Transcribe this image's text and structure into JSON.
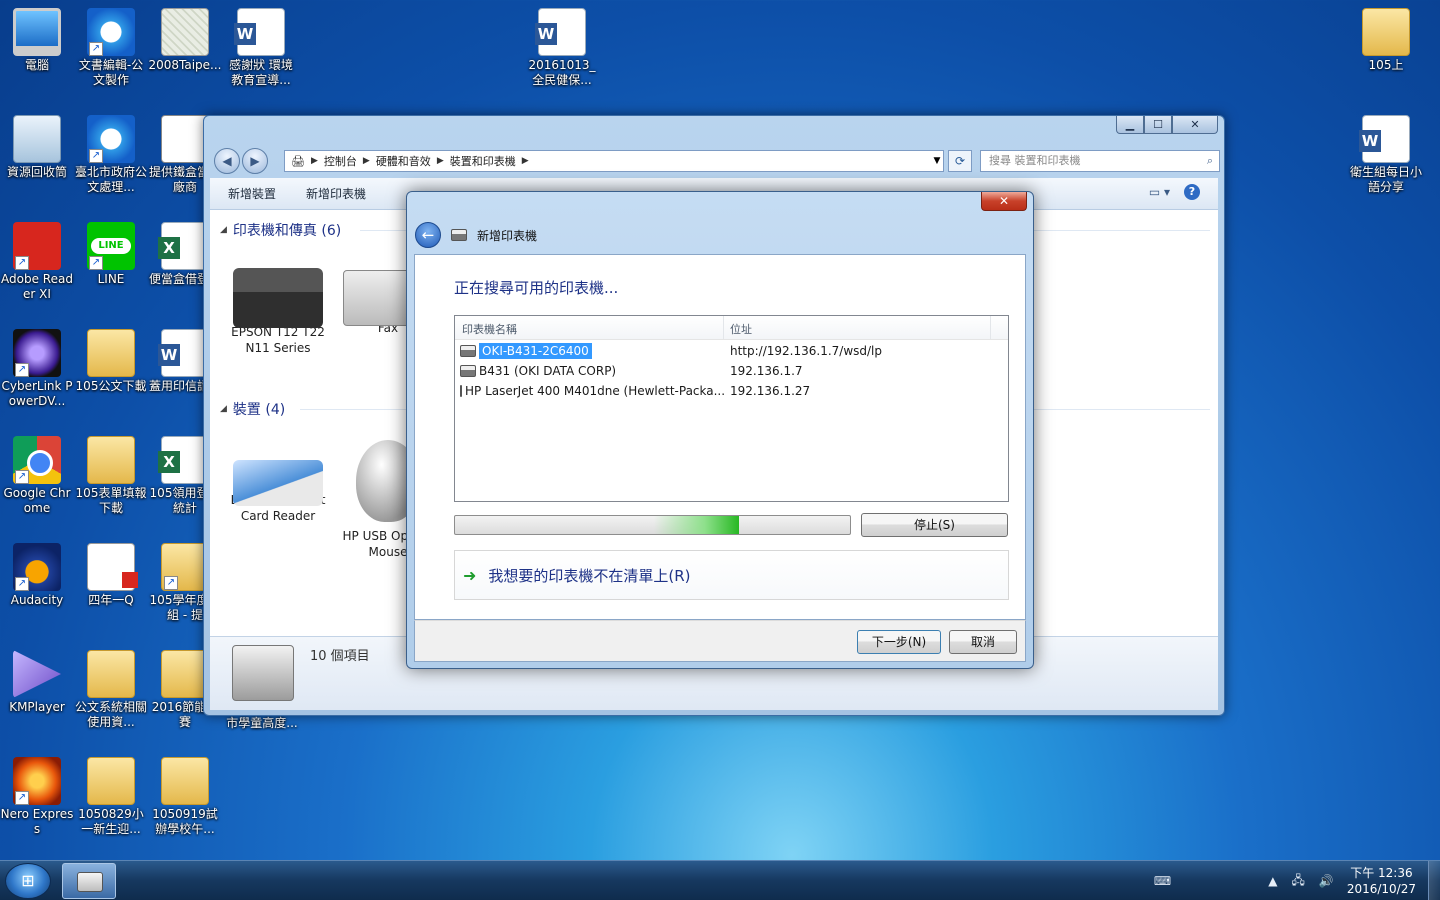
{
  "desktop": {
    "icons": [
      {
        "label": "電腦"
      },
      {
        "label": "文書編輯-公文製作"
      },
      {
        "label": "2008Taipe..."
      },
      {
        "label": "感謝狀 環境教育宣導..."
      },
      {
        "label": "20161013_全民健保..."
      },
      {
        "label": "105上"
      },
      {
        "label": "資源回收筒"
      },
      {
        "label": "臺北市政府公文處理..."
      },
      {
        "label": "提供鐵盒當之廠商"
      },
      {
        "label": "衛生組每日小語分享"
      },
      {
        "label": "Adobe Reader XI"
      },
      {
        "label": "LINE"
      },
      {
        "label": "便當盒借登記"
      },
      {
        "label": "CyberLink PowerDV..."
      },
      {
        "label": "105公文下載"
      },
      {
        "label": "蓋用印信請表"
      },
      {
        "label": "Google Chrome"
      },
      {
        "label": "105表單填報下載"
      },
      {
        "label": "105領用登記統計"
      },
      {
        "label": "Audacity"
      },
      {
        "label": "四年一Q"
      },
      {
        "label": "105學年度生組 - 提"
      },
      {
        "label": "KMPlayer"
      },
      {
        "label": "公文系統相關使用資..."
      },
      {
        "label": "2016節能競賽"
      },
      {
        "label": "Nero Express"
      },
      {
        "label": "1050829小一新生迎..."
      },
      {
        "label": "1050919試辦學校午..."
      },
      {
        "label": "市學童高度..."
      }
    ]
  },
  "explorer": {
    "breadcrumb": [
      "控制台",
      "硬體和音效",
      "裝置和印表機"
    ],
    "search_placeholder": "搜尋 裝置和印表機",
    "toolbar": {
      "add_device": "新增裝置",
      "add_printer": "新增印表機"
    },
    "groups": {
      "printers_title": "印表機和傳真 (6)",
      "devices_title": "裝置 (4)"
    },
    "printers": [
      {
        "label": "EPSON T12 T22 N11 Series"
      },
      {
        "label": "Fax"
      }
    ],
    "devices": [
      {
        "label": "EZ100PU Smart Card Reader"
      },
      {
        "label": "HP USB Optical Mouse"
      }
    ],
    "status": {
      "count": "10 個項目"
    }
  },
  "dialog": {
    "window_title": "新增印表機",
    "heading": "正在搜尋可用的印表機...",
    "columns": {
      "name": "印表機名稱",
      "address": "位址"
    },
    "rows": [
      {
        "name": "OKI-B431-2C6400",
        "address": "http://192.136.1.7/wsd/lp"
      },
      {
        "name": "B431 (OKI DATA CORP)",
        "address": "192.136.1.7"
      },
      {
        "name": "HP LaserJet 400 M401dne (Hewlett-Packa...",
        "address": "192.136.1.27"
      }
    ],
    "progress": 0.72,
    "stop_button": "停止(S)",
    "not_listed_link": "我想要的印表機不在清單上(R)",
    "next_button": "下一步(N)",
    "cancel_button": "取消"
  },
  "taskbar": {
    "clock_time": "下午 12:36",
    "clock_date": "2016/10/27"
  }
}
